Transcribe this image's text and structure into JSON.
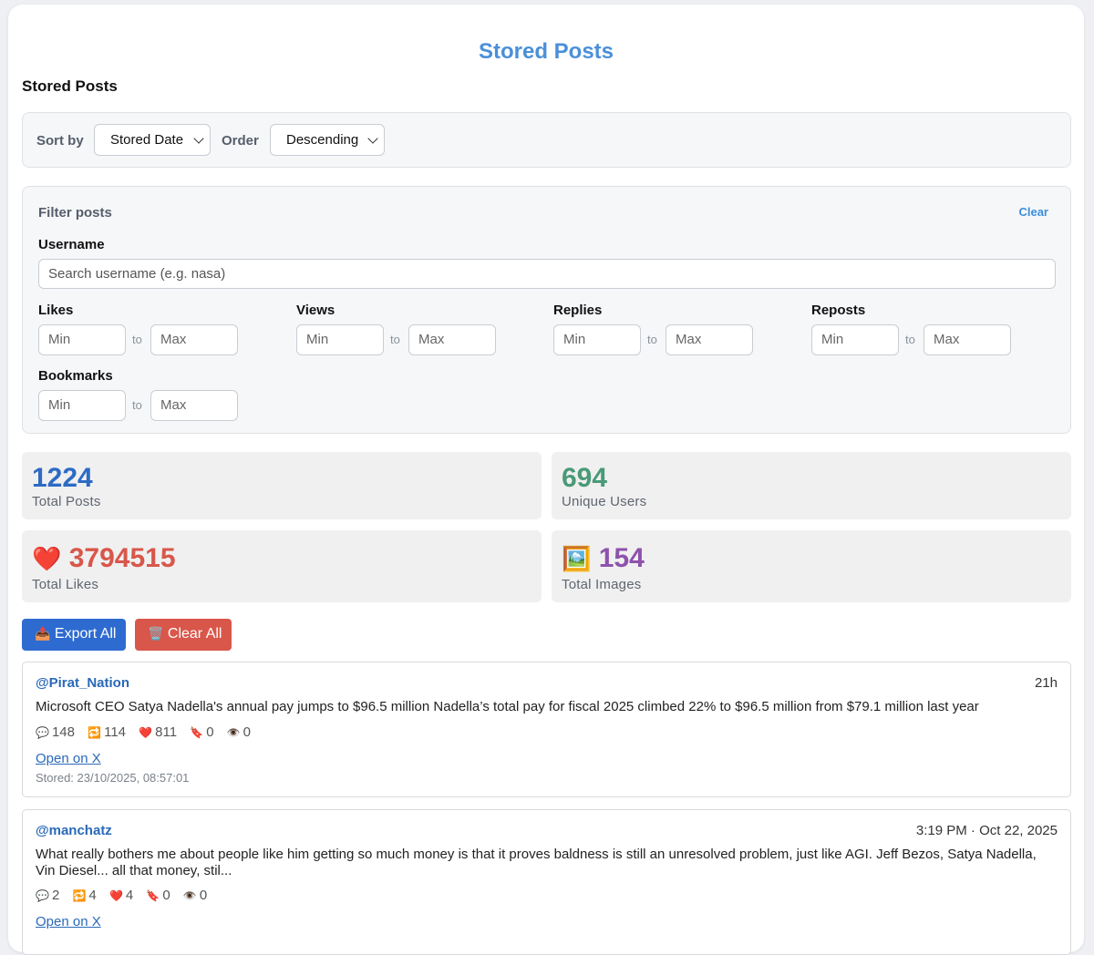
{
  "app_title": "Stored Posts",
  "section_title": "Stored Posts",
  "sort": {
    "sort_by_label": "Sort by",
    "sort_by_value": "Stored Date",
    "order_label": "Order",
    "order_value": "Descending"
  },
  "filter": {
    "heading": "Filter posts",
    "clear_label": "Clear",
    "username_label": "Username",
    "username_placeholder": "Search username (e.g. nasa)",
    "ranges": [
      {
        "label": "Likes",
        "min": "Min",
        "to": "to",
        "max": "Max"
      },
      {
        "label": "Views",
        "min": "Min",
        "to": "to",
        "max": "Max"
      },
      {
        "label": "Replies",
        "min": "Min",
        "to": "to",
        "max": "Max"
      },
      {
        "label": "Reposts",
        "min": "Min",
        "to": "to",
        "max": "Max"
      },
      {
        "label": "Bookmarks",
        "min": "Min",
        "to": "to",
        "max": "Max"
      }
    ]
  },
  "stats": {
    "total_posts": {
      "value": "1224",
      "label": "Total Posts",
      "color": "#2d6bc4"
    },
    "unique_users": {
      "value": "694",
      "label": "Unique Users",
      "color": "#4a9a77"
    },
    "total_likes": {
      "icon": "❤️",
      "value": "3794515",
      "label": "Total Likes",
      "color": "#d9564a"
    },
    "total_images": {
      "icon": "🖼️",
      "value": "154",
      "label": "Total Images",
      "color": "#8e52ad"
    }
  },
  "actions": {
    "export_icon": "📤",
    "export_label": "Export All",
    "export_color": "#2e6bd0",
    "clear_icon": "🗑️",
    "clear_label": "Clear All",
    "clear_color": "#d9564a"
  },
  "posts": [
    {
      "username": "@Pirat_Nation",
      "time": "21h",
      "text": "Microsoft CEO Satya Nadella's annual pay jumps to $96.5 million Nadella’s total pay for fiscal 2025 climbed 22% to $96.5 million from $79.1 million last year",
      "replies": "148",
      "reposts": "114",
      "likes": "811",
      "bookmarks": "0",
      "views": "0",
      "open_label": "Open on X",
      "stored": "Stored: 23/10/2025, 08:57:01"
    },
    {
      "username": "@manchatz",
      "time": "3:19 PM · Oct 22, 2025",
      "text": "What really bothers me about people like him getting so much money is that it proves baldness is still an unresolved problem, just like AGI. Jeff Bezos, Satya Nadella, Vin Diesel... all that money, stil...",
      "replies": "2",
      "reposts": "4",
      "likes": "4",
      "bookmarks": "0",
      "views": "0",
      "open_label": "Open on X"
    }
  ],
  "icons": {
    "reply": "💬",
    "repost": "🔁",
    "like": "❤️",
    "bookmark": "🔖",
    "view": "👁️"
  }
}
